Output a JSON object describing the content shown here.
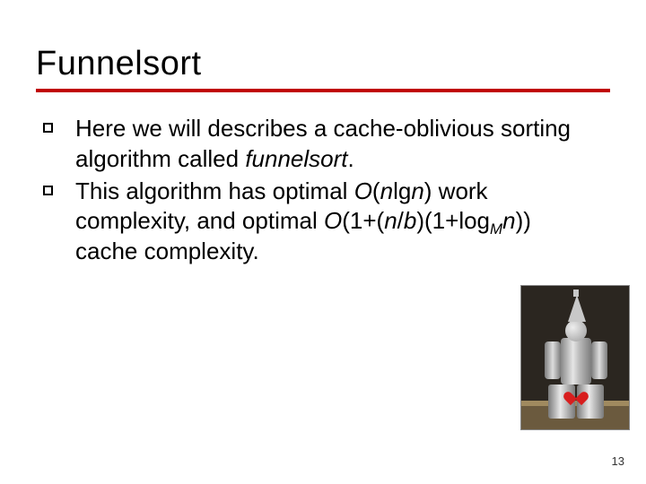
{
  "title": "Funnelsort",
  "bullets": [
    {
      "prefix": "Here we will describes a cache-oblivious sorting algorithm called ",
      "emph": "funnelsort",
      "suffix": "."
    },
    {
      "line1_a": "This algorithm has optimal ",
      "line1_b": "O",
      "line1_c": "(",
      "line1_d": "n",
      "line1_e": "lg",
      "line1_f": "n",
      "line1_g": ") work complexity, and optimal ",
      "line2_a": "O",
      "line2_b": "(1+(",
      "line2_c": "n",
      "line2_d": "/",
      "line2_e": "b",
      "line2_f": ")(1+log",
      "line2_sub": "M",
      "line2_g": "n",
      "line2_h": ")) cache complexity."
    }
  ],
  "page_number": "13",
  "figure_alt": "tin-man-photo"
}
